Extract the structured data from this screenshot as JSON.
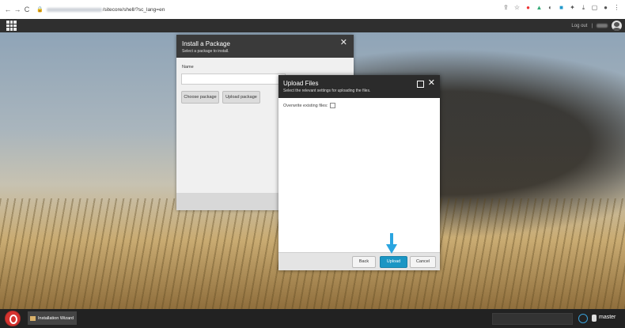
{
  "browser": {
    "url_suffix": "/sitecore/shell/?sc_lang=en",
    "nav": {
      "back": "←",
      "forward": "→",
      "reload": "C"
    },
    "icons": [
      "share-icon",
      "star-icon",
      "opera-icon",
      "extension-icon",
      "extension-icon",
      "puzzle-icon",
      "download-icon",
      "window-icon",
      "profile-icon",
      "menu-icon"
    ]
  },
  "topbar": {
    "logout_label": "Log out",
    "separator": "|"
  },
  "install_dialog": {
    "title": "Install a Package",
    "subtitle": "Select a package to install.",
    "name_label": "Name",
    "name_value": "",
    "choose_label": "Choose package",
    "upload_label": "Upload package",
    "close_glyph": "✕"
  },
  "upload_dialog": {
    "title": "Upload Files",
    "subtitle": "Select the relevant settings for uploading the files.",
    "overwrite_label": "Overwrite existing files:",
    "overwrite_checked": false,
    "close_glyph": "✕",
    "back_label": "Back",
    "upload_label": "Upload",
    "cancel_label": "Cancel",
    "accent": "#1b96c4"
  },
  "taskbar": {
    "task_label": "Installation Wizard",
    "database_label": "master"
  }
}
